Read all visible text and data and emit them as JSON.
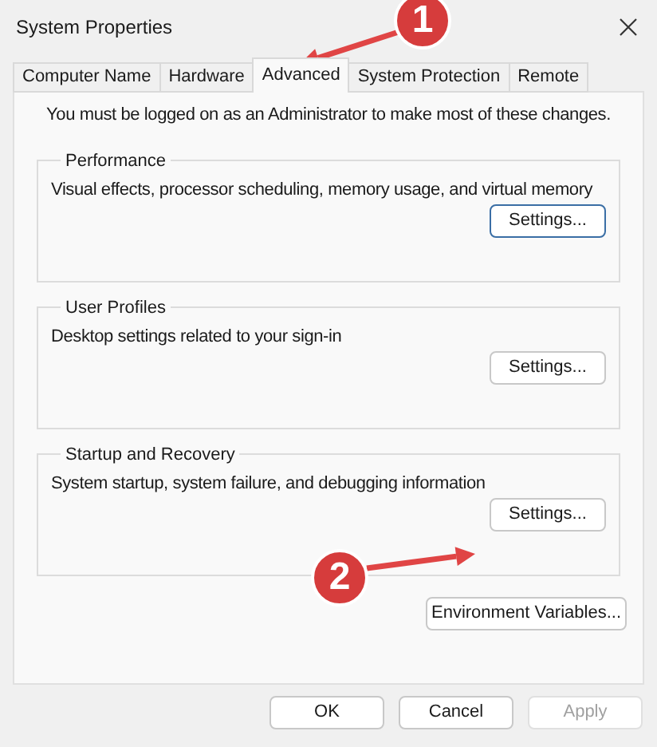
{
  "window": {
    "title": "System Properties"
  },
  "tabs": [
    {
      "label": "Computer Name",
      "selected": false
    },
    {
      "label": "Hardware",
      "selected": false
    },
    {
      "label": "Advanced",
      "selected": true
    },
    {
      "label": "System Protection",
      "selected": false
    },
    {
      "label": "Remote",
      "selected": false
    }
  ],
  "notice": "You must be logged on as an Administrator to make most of these changes.",
  "groups": [
    {
      "title": "Performance",
      "description": "Visual effects, processor scheduling, memory usage, and virtual memory",
      "button": {
        "label": "Settings...",
        "focused": true
      }
    },
    {
      "title": "User Profiles",
      "description": "Desktop settings related to your sign-in",
      "button": {
        "label": "Settings...",
        "focused": false
      }
    },
    {
      "title": "Startup and Recovery",
      "description": "System startup, system failure, and debugging information",
      "button": {
        "label": "Settings...",
        "focused": false
      }
    }
  ],
  "environment_button": {
    "label": "Environment Variables..."
  },
  "buttons": [
    {
      "label": "OK",
      "disabled": false
    },
    {
      "label": "Cancel",
      "disabled": false
    },
    {
      "label": "Apply",
      "disabled": true
    }
  ],
  "annotations": [
    {
      "label": "1"
    },
    {
      "label": "2"
    }
  ]
}
